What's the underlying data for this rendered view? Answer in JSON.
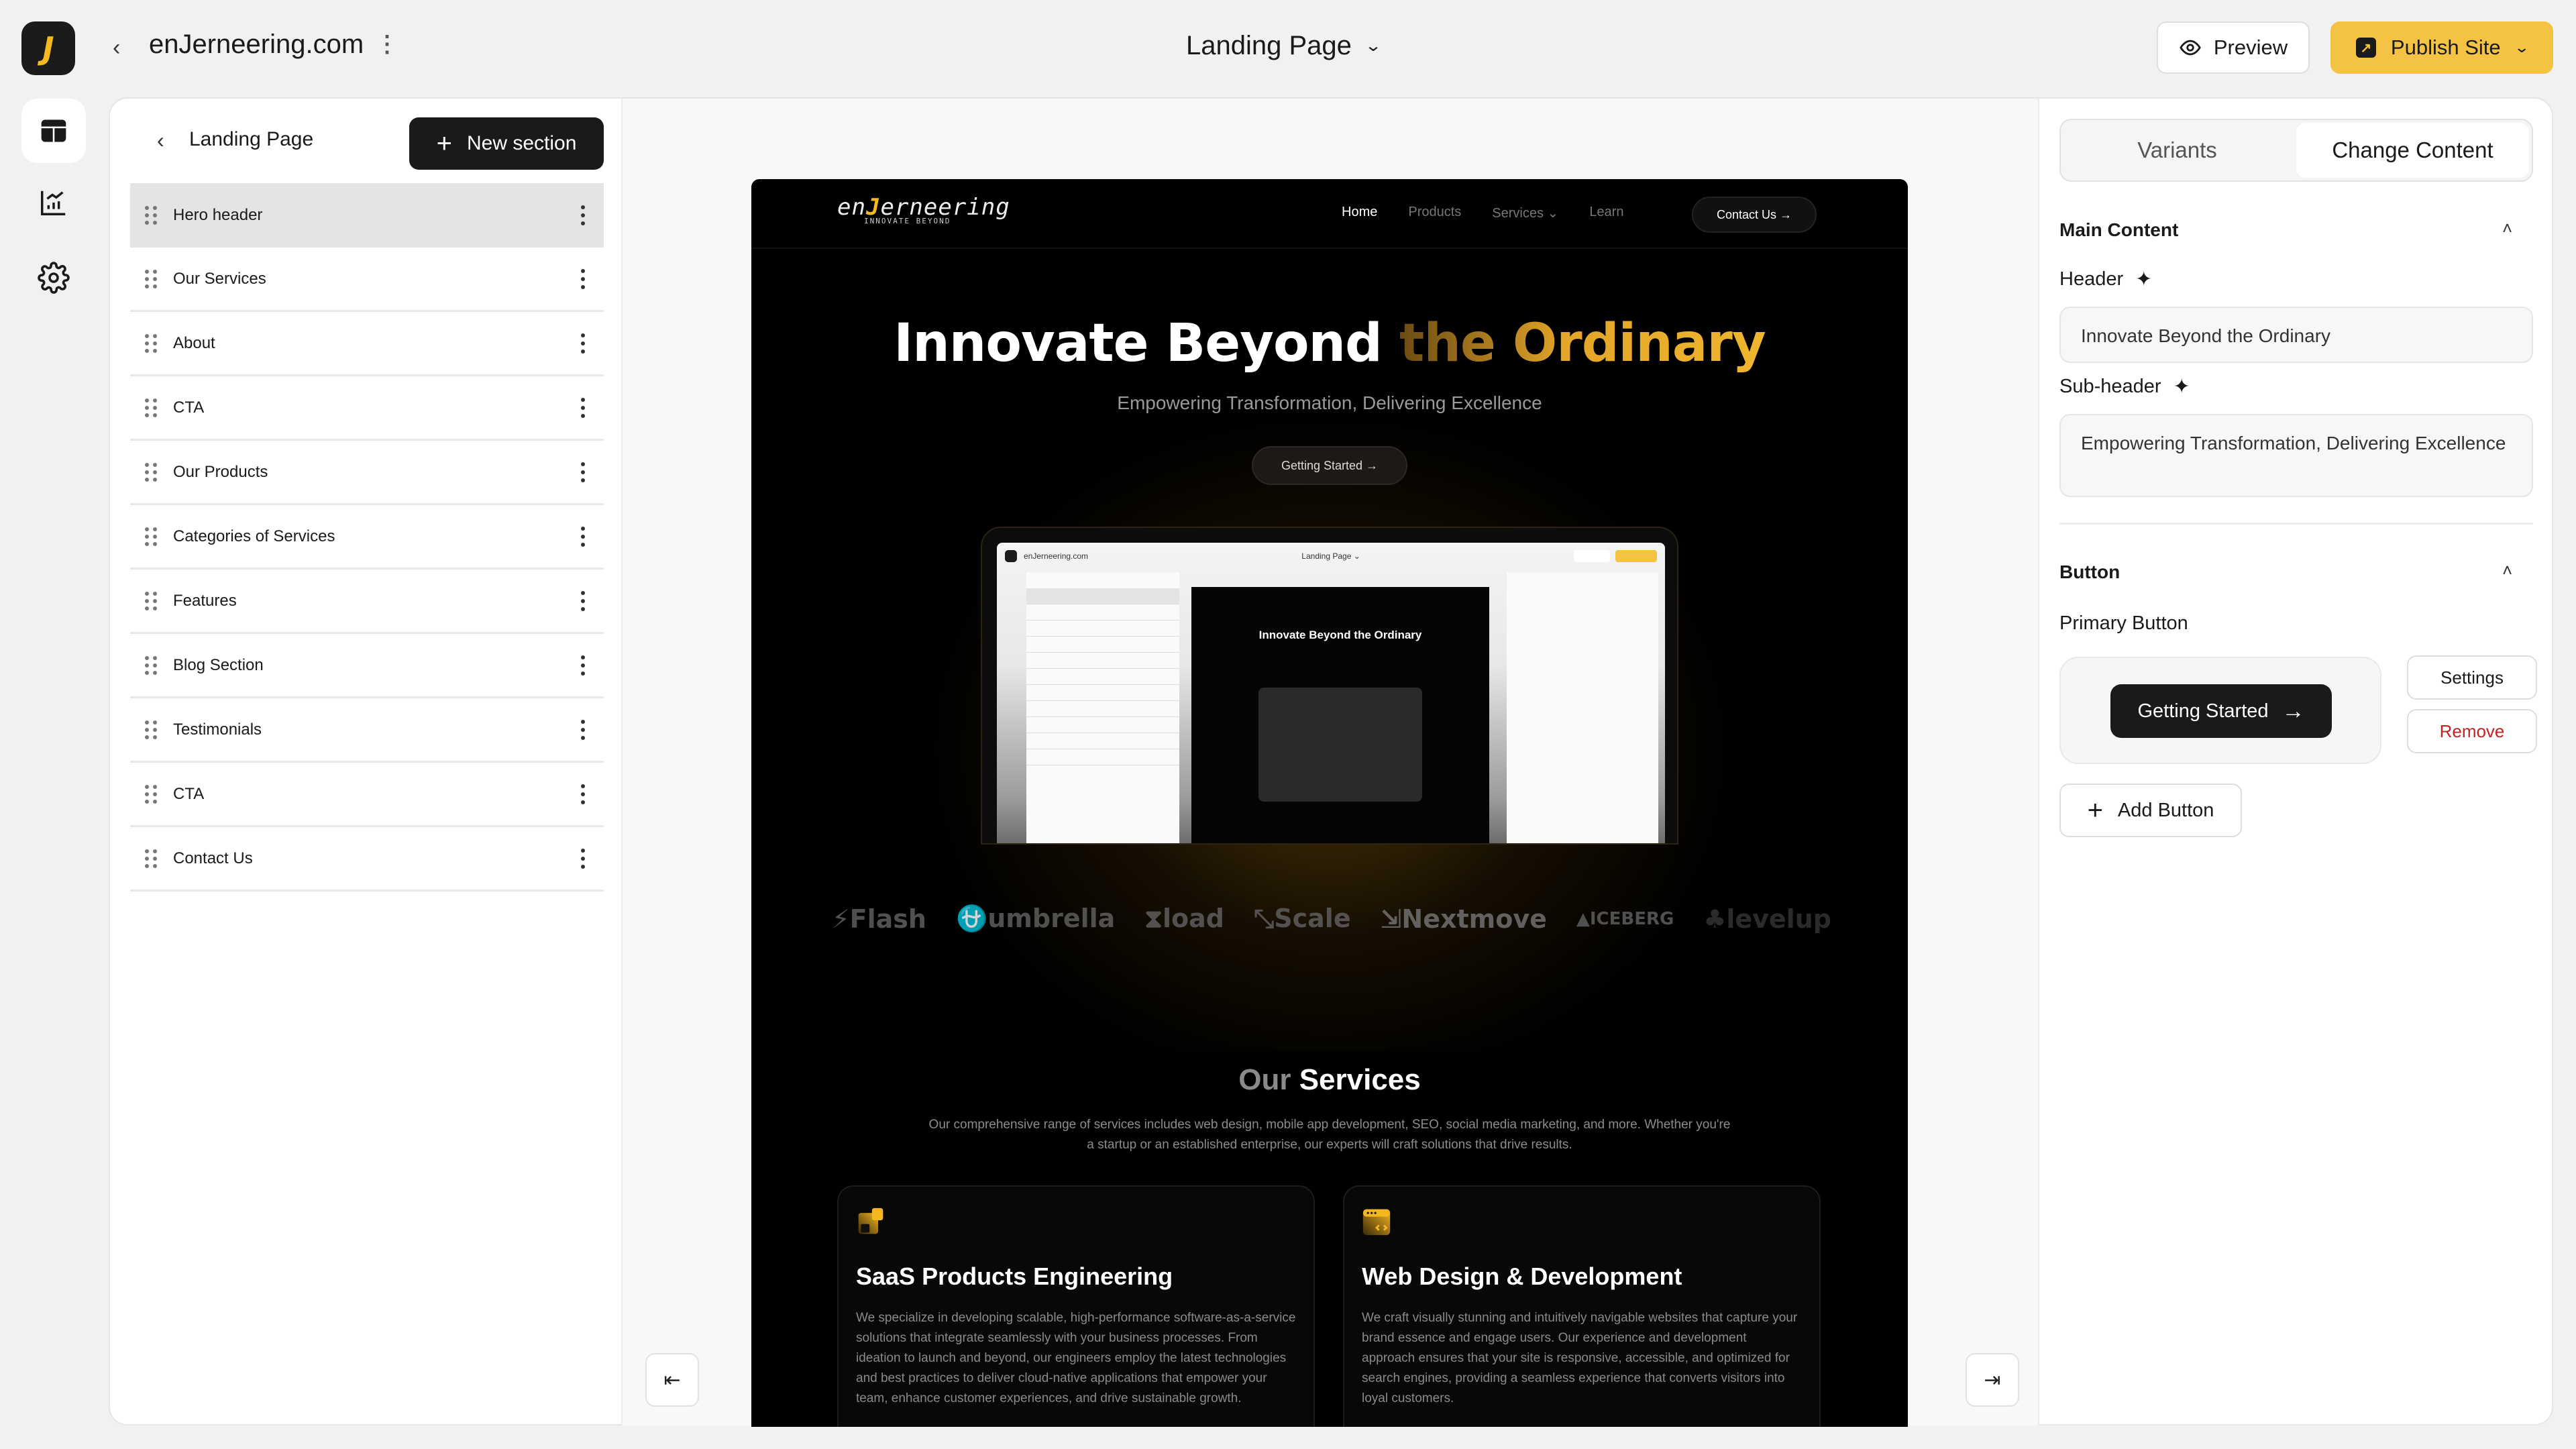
{
  "topbar": {
    "app_logo_letter": "J",
    "back_icon": "chevron-left-icon",
    "site_name": "enJerneering.com",
    "more_icon": "more-vertical-icon",
    "page_selector": "Landing Page",
    "preview_label": "Preview",
    "publish_label": "Publish Site",
    "publish_color": "#f5c343"
  },
  "rail": {
    "items": [
      {
        "icon": "layout-icon",
        "active": true
      },
      {
        "icon": "analytics-chart-icon",
        "active": false
      },
      {
        "icon": "settings-gear-icon",
        "active": false
      }
    ]
  },
  "sidebar": {
    "title": "Landing Page",
    "new_section_label": "New section",
    "sections": [
      {
        "label": "Hero header",
        "active": true
      },
      {
        "label": "Our Services"
      },
      {
        "label": "About"
      },
      {
        "label": "CTA"
      },
      {
        "label": "Our Products"
      },
      {
        "label": "Categories of Services"
      },
      {
        "label": "Features"
      },
      {
        "label": "Blog Section"
      },
      {
        "label": "Testimonials"
      },
      {
        "label": "CTA"
      },
      {
        "label": "Contact Us"
      }
    ]
  },
  "canvas": {
    "collapse_left_icon": "collapse-left-icon",
    "collapse_right_icon": "collapse-right-icon",
    "site": {
      "logo_word_a": "en",
      "logo_word_j": "J",
      "logo_word_b": "erneering",
      "logo_tagline": "INNOVATE BEYOND",
      "nav": [
        "Home",
        "Products",
        "Services ⌄",
        "Learn"
      ],
      "nav_active": "Home",
      "contact_label": "Contact Us →",
      "hero_title_white": "Innovate Beyond ",
      "hero_title_gold": "the Ordinary",
      "hero_subtitle": "Empowering Transformation, Delivering Excellence",
      "hero_cta": "Getting Started →",
      "mini_site_name": "enJerneering.com",
      "mini_page": "Landing Page ⌄",
      "mini_hero": "Innovate Beyond the Ordinary",
      "partner_logos": [
        "⚡Flash",
        "⛎umbrella",
        "⧗load",
        "⤡Scale",
        "⇲Nextmove",
        "▲ICEBERG",
        "♣levelup"
      ],
      "services_title_dim": "Our ",
      "services_title": "Services",
      "services_desc": "Our comprehensive range of services includes web design, mobile app development, SEO, social media marketing, and more. Whether you're a startup or an established enterprise, our experts will craft solutions that drive results.",
      "cards": [
        {
          "icon": "saas-blocks-icon",
          "title": "SaaS Products Engineering",
          "body": "We specialize in developing scalable, high-performance software-as-a-service solutions that integrate seamlessly with your business processes. From ideation to launch and beyond, our engineers employ the latest technologies and best practices to deliver cloud-native applications that empower your team, enhance customer experiences, and drive sustainable growth."
        },
        {
          "icon": "browser-code-icon",
          "title": "Web Design & Development",
          "body": "We craft visually stunning and intuitively navigable websites that capture your brand essence and engage users. Our experience and development approach ensures that your site is responsive, accessible, and optimized for search engines, providing a seamless experience that converts visitors into loyal customers."
        }
      ]
    }
  },
  "rpanel": {
    "tabs": [
      "Variants",
      "Change Content"
    ],
    "active_tab": "Change Content",
    "main_content_title": "Main Content",
    "header_label": "Header",
    "header_value": "Innovate Beyond the Ordinary",
    "subheader_label": "Sub-header",
    "subheader_value": "Empowering Transformation, Delivering Excellence",
    "button_section_title": "Button",
    "primary_button_label": "Primary Button",
    "primary_button_text": "Getting Started",
    "settings_label": "Settings",
    "remove_label": "Remove",
    "add_button_label": "Add Button",
    "remove_color": "#c42323"
  }
}
